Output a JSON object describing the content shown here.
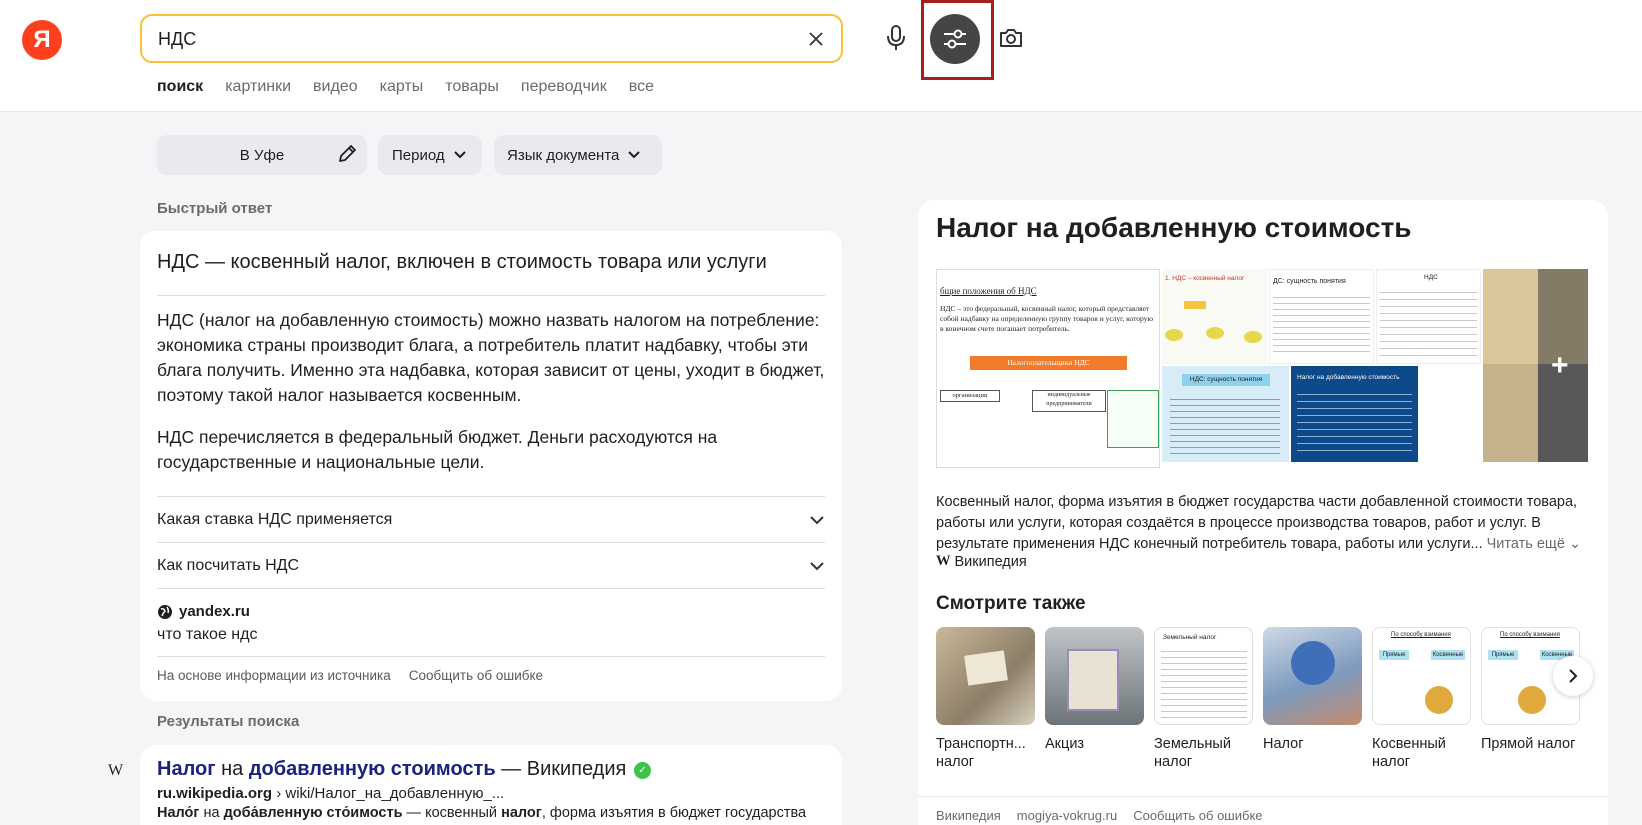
{
  "header": {
    "logo_letter": "Я",
    "search_value": "НДС",
    "tabs": [
      "поиск",
      "картинки",
      "видео",
      "карты",
      "товары",
      "переводчик",
      "все"
    ]
  },
  "filters": {
    "region": "В Уфе",
    "period": "Период",
    "language": "Язык документа"
  },
  "quick_answer": {
    "section_label": "Быстрый ответ",
    "title": "НДС — косвенный налог, включен в стоимость товара или услуги",
    "para1": "НДС (налог на добавленную стоимость) можно назвать налогом на потребление: экономика страны производит блага, а потребитель платит надбавку, чтобы эти блага получить. Именно эта надбавка, которая зависит от цены, уходит в бюджет, поэтому такой налог называется косвенным.",
    "para2": "НДС перечисляется в федеральный бюджет. Деньги расходуются на государственные и национальные цели.",
    "faq": [
      "Какая ставка НДС применяется",
      "Как посчитать НДС"
    ],
    "source_domain": "yandex.ru",
    "source_link": "что такое ндс",
    "footer_left": "На основе информации из источника",
    "footer_right": "Сообщить об ошибке"
  },
  "results": {
    "section_label": "Результаты поиска",
    "title_parts": [
      "Налог",
      " на ",
      "добавленную стоимость",
      " — Википедия"
    ],
    "url_domain": "ru.wikipedia.org",
    "url_path": " › wiki/Налог_на_добавленную_...",
    "snippet_parts": [
      "Нало́г",
      " на ",
      "доба́вленную сто́имость",
      " — косвенный ",
      "налог",
      ", форма изъятия в бюджет государства"
    ],
    "favicon": "W"
  },
  "panel": {
    "title": "Налог на добавленную стоимость",
    "description": "Косвенный налог, форма изъятия в бюджет государства части добавленной стоимости товара, работы или услуги, которая создаётся в процессе производства товаров, работ и услуг. В результате применения НДС конечный потребитель товара, работы или услуги...",
    "read_more": "Читать ещё",
    "wiki_label": "Википедия",
    "see_also_title": "Смотрите также",
    "related": [
      {
        "label": "Транспортн... налог"
      },
      {
        "label": "Акциз"
      },
      {
        "label": "Земельный налог"
      },
      {
        "label": "Налог"
      },
      {
        "label": "Косвенный налог"
      },
      {
        "label": "Прямой налог"
      }
    ],
    "footer_links": [
      "Википедия",
      "mogiya-vokrug.ru",
      "Сообщить об ошибке"
    ],
    "gallery_texts": {
      "g1_heading": "бщие положения об НДС",
      "g1_body": "НДС – это федеральный, косвенный налог, который представляет собой надбавку на определенную группу товаров и услуг, которую в конечном счете погашает потребитель.",
      "g1_box": "Налогоплательщики НДС",
      "g1_sub1": "организации",
      "g1_sub2": "индивидуальные предприниматели",
      "g2_heading": "1. НДС – косвенный налог",
      "g3_heading": "ДС: сущность понятия",
      "g4_heading": "НДС",
      "g6_heading": "НДС: сущность понятия",
      "g7_heading": "Налог на добавленную стоимость"
    },
    "related_texts": {
      "r3_title": "Земельный налог",
      "r5_title": "По способу взимания",
      "r5_left": "Прямые",
      "r5_right": "Косвенные",
      "r6_title": "По способу взимания",
      "r6_left": "Прямые",
      "r6_right": "Косвенные"
    }
  },
  "colors": {
    "accent_yellow": "#fbbf2f",
    "logo_red": "#fc3f1d",
    "highlight_red": "#a41f1f",
    "link_dark_blue": "#1a237e",
    "filter_btn_bg": "#454545"
  }
}
